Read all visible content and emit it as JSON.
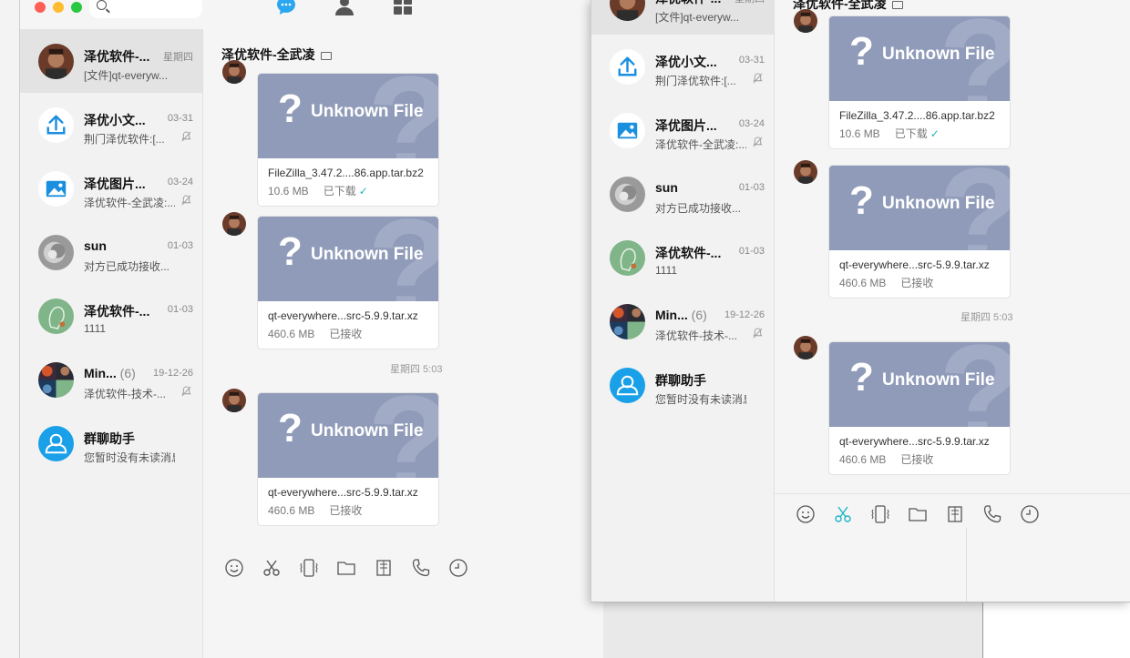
{
  "search": {
    "placeholder": ""
  },
  "windowA": {
    "chat_title": "泽优软件-全武凌",
    "conversations": [
      {
        "name": "泽优软件-...",
        "count": "",
        "date": "星期四",
        "sub": "[文件]qt-everyw...",
        "muted": false
      },
      {
        "name": "泽优小文...",
        "count": "",
        "date": "03-31",
        "sub": "荆门泽优软件:[...",
        "muted": true
      },
      {
        "name": "泽优图片...",
        "count": "",
        "date": "03-24",
        "sub": "泽优软件-全武凌:...",
        "muted": true
      },
      {
        "name": "sun",
        "count": "",
        "date": "01-03",
        "sub": "对方已成功接收...",
        "muted": false
      },
      {
        "name": "泽优软件-...",
        "count": "",
        "date": "01-03",
        "sub": "1111",
        "muted": false
      },
      {
        "name": "Min...",
        "count": "(6)",
        "date": "19-12-26",
        "sub": "泽优软件-技术-...",
        "muted": true
      },
      {
        "name": "群聊助手",
        "count": "",
        "date": "",
        "sub": "您暂时没有未读消息",
        "muted": false
      }
    ],
    "files": [
      {
        "name": "FileZilla_3.47.2....86.app.tar.bz2",
        "size": "10.6 MB",
        "status": "已下载",
        "check": "✓"
      },
      {
        "name": "qt-everywhere...src-5.9.9.tar.xz",
        "size": "460.6 MB",
        "status": "已接收",
        "check": ""
      },
      {
        "name": "qt-everywhere...src-5.9.9.tar.xz",
        "size": "460.6 MB",
        "status": "已接收",
        "check": ""
      }
    ],
    "timestamp": "星期四  5:03"
  },
  "windowB": {
    "chat_title": "泽优软件-全武凌",
    "conversations": [
      {
        "name": "泽优软件-...",
        "count": "",
        "date": "星期四",
        "sub": "[文件]qt-everyw...",
        "muted": false
      },
      {
        "name": "泽优小文...",
        "count": "",
        "date": "03-31",
        "sub": "荆门泽优软件:[...",
        "muted": true
      },
      {
        "name": "泽优图片...",
        "count": "",
        "date": "03-24",
        "sub": "泽优软件-全武凌:...",
        "muted": true
      },
      {
        "name": "sun",
        "count": "",
        "date": "01-03",
        "sub": "对方已成功接收...",
        "muted": false
      },
      {
        "name": "泽优软件-...",
        "count": "",
        "date": "01-03",
        "sub": "1111",
        "muted": false
      },
      {
        "name": "Min...",
        "count": "(6)",
        "date": "19-12-26",
        "sub": "泽优软件-技术-...",
        "muted": true
      },
      {
        "name": "群聊助手",
        "count": "",
        "date": "",
        "sub": "您暂时没有未读消息",
        "muted": false
      }
    ],
    "files": [
      {
        "name": "FileZilla_3.47.2....86.app.tar.bz2",
        "size": "10.6 MB",
        "status": "已下载",
        "check": "✓"
      },
      {
        "name": "qt-everywhere...src-5.9.9.tar.xz",
        "size": "460.6 MB",
        "status": "已接收",
        "check": ""
      },
      {
        "name": "qt-everywhere...src-5.9.9.tar.xz",
        "size": "460.6 MB",
        "status": "已接收",
        "check": ""
      }
    ],
    "timestamp": "星期四  5:03"
  },
  "file_thumb": {
    "label": "Unknown File",
    "glyph": "?"
  },
  "icons": {
    "toolbar": [
      "smiley-icon",
      "scissors-icon",
      "vibrate-icon",
      "folder-icon",
      "sticker-icon",
      "phone-icon",
      "clock-icon"
    ],
    "top_nav": [
      "chat-bubble-icon",
      "contacts-icon",
      "apps-grid-icon"
    ]
  },
  "colors": {
    "accent": "#1fb5c5",
    "file_thumb": "#8f9bb8",
    "assistant_blue": "#1aa0e8",
    "nav_active": "#2aa7f0"
  }
}
